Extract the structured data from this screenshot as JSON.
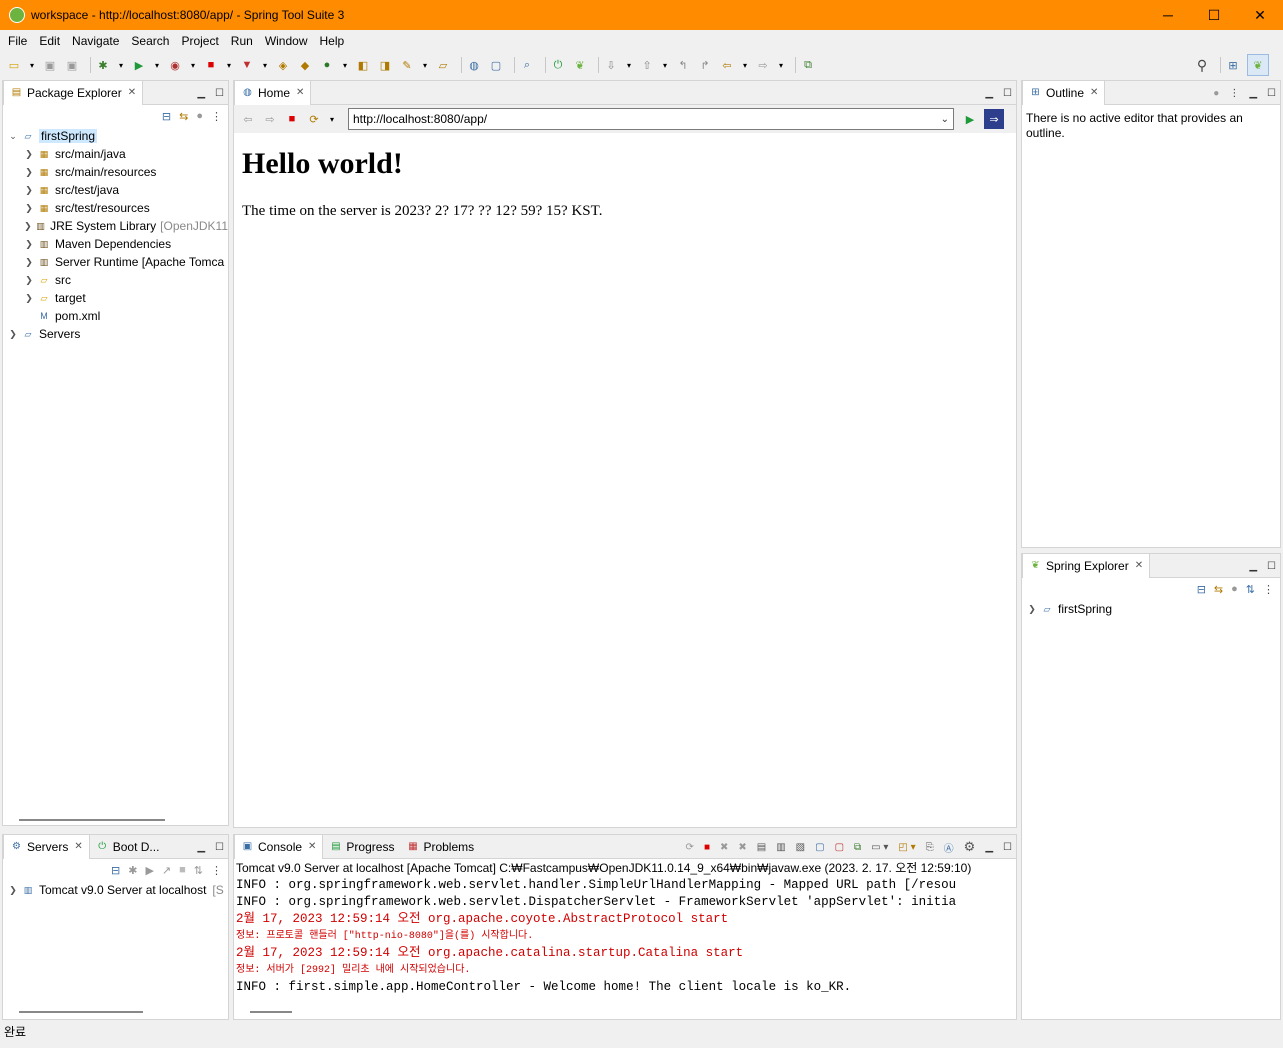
{
  "window": {
    "title": "workspace - http://localhost:8080/app/ - Spring Tool Suite 3",
    "controls": [
      "─",
      "☐",
      "✕"
    ]
  },
  "menu": [
    "File",
    "Edit",
    "Navigate",
    "Search",
    "Project",
    "Run",
    "Window",
    "Help"
  ],
  "package_explorer": {
    "tab_label": "Package Explorer",
    "items": [
      {
        "label": "firstSpring",
        "depth": 0,
        "icon": "project-icon",
        "expanded": true
      },
      {
        "label": "src/main/java",
        "depth": 1,
        "icon": "source-folder-icon"
      },
      {
        "label": "src/main/resources",
        "depth": 1,
        "icon": "source-folder-icon"
      },
      {
        "label": "src/test/java",
        "depth": 1,
        "icon": "source-folder-icon"
      },
      {
        "label": "src/test/resources",
        "depth": 1,
        "icon": "source-folder-icon"
      },
      {
        "label": "JRE System Library",
        "suffix": "[OpenJDK11",
        "depth": 1,
        "icon": "library-icon"
      },
      {
        "label": "Maven Dependencies",
        "depth": 1,
        "icon": "library-icon"
      },
      {
        "label": "Server Runtime [Apache Tomca",
        "depth": 1,
        "icon": "library-icon"
      },
      {
        "label": "src",
        "depth": 1,
        "icon": "folder-icon"
      },
      {
        "label": "target",
        "depth": 1,
        "icon": "folder-icon"
      },
      {
        "label": "pom.xml",
        "depth": 1,
        "icon": "xml-file-icon",
        "leaf": true
      },
      {
        "label": "Servers",
        "depth": 0,
        "icon": "project-icon"
      }
    ]
  },
  "editor": {
    "tab_label": "Home",
    "url": "http://localhost:8080/app/",
    "heading": "Hello world!",
    "body_text": "The time on the server is 2023? 2? 17? ?? 12? 59? 15? KST."
  },
  "outline": {
    "tab_label": "Outline",
    "message": "There is no active editor that provides an outline."
  },
  "spring_explorer": {
    "tab_label": "Spring Explorer",
    "items": [
      "firstSpring"
    ]
  },
  "servers_view": {
    "tab_label": "Servers",
    "second_tab_label": "Boot D...",
    "items": [
      {
        "label": "Tomcat v9.0 Server at localhost",
        "suffix": "[S"
      }
    ]
  },
  "console": {
    "tabs": [
      "Console",
      "Progress",
      "Problems"
    ],
    "header": "Tomcat v9.0 Server at localhost [Apache Tomcat] C:₩Fastcampus₩OpenJDK11.0.14_9_x64₩bin₩javaw.exe  (2023. 2. 17. 오전 12:59:10)",
    "lines": [
      {
        "text": "INFO : org.springframework.web.servlet.handler.SimpleUrlHandlerMapping - Mapped URL path [/resou",
        "color": "black",
        "size": "normal"
      },
      {
        "text": "INFO : org.springframework.web.servlet.DispatcherServlet - FrameworkServlet 'appServlet': initia",
        "color": "black",
        "size": "normal"
      },
      {
        "text": "2월 17, 2023 12:59:14 오전 org.apache.coyote.AbstractProtocol start",
        "color": "red",
        "size": "normal"
      },
      {
        "text": "정보: 프로토콜 핸들러 [\"http-nio-8080\"]을(를) 시작합니다.",
        "color": "red",
        "size": "small"
      },
      {
        "text": "2월 17, 2023 12:59:14 오전 org.apache.catalina.startup.Catalina start",
        "color": "red",
        "size": "normal"
      },
      {
        "text": "정보: 서버가 [2992] 밀리초 내에 시작되었습니다.",
        "color": "red",
        "size": "small"
      },
      {
        "text": "INFO : first.simple.app.HomeController - Welcome home! The client locale is ko_KR.",
        "color": "black",
        "size": "normal"
      }
    ]
  },
  "status": {
    "text": "완료"
  },
  "colors": {
    "title_bar": "#ff8c00",
    "console_red": "#d00000"
  }
}
